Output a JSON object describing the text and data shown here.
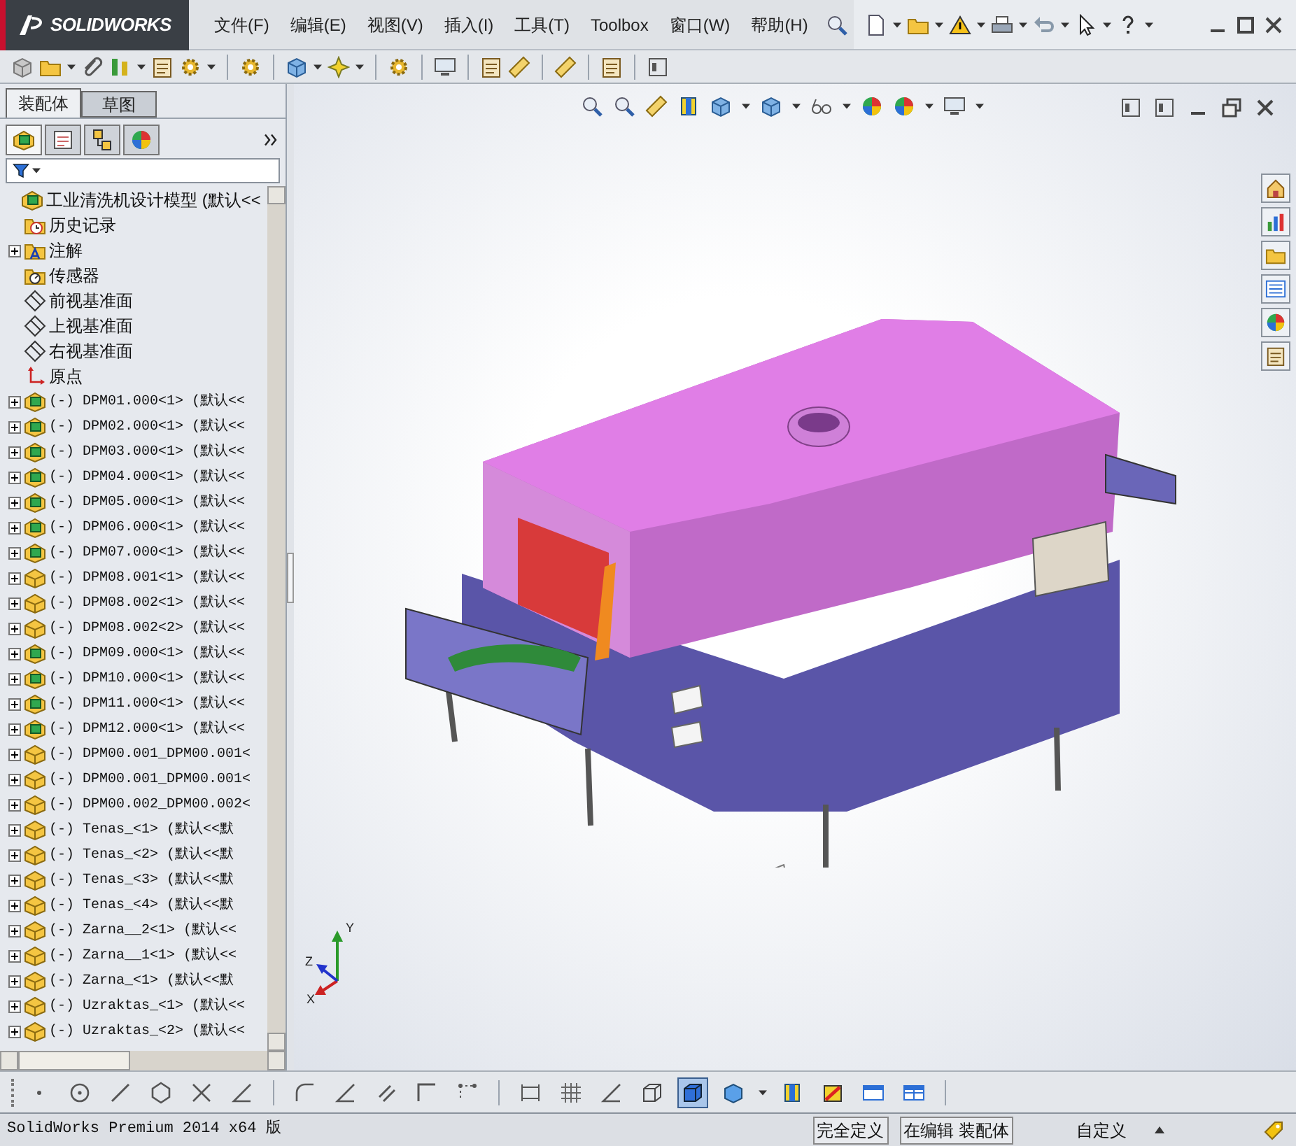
{
  "window": {
    "logo": "SOLIDWORKS"
  },
  "menu": [
    {
      "label": "文件(F)"
    },
    {
      "label": "编辑(E)"
    },
    {
      "label": "视图(V)"
    },
    {
      "label": "插入(I)"
    },
    {
      "label": "工具(T)"
    },
    {
      "label": "Toolbox"
    },
    {
      "label": "窗口(W)"
    },
    {
      "label": "帮助(H)"
    }
  ],
  "panel_tabs": [
    {
      "label": "装配体",
      "selected": true
    },
    {
      "label": "草图",
      "selected": false
    }
  ],
  "manager_tabs": [
    {
      "kind": "tree",
      "selected": true
    },
    {
      "kind": "property",
      "selected": false
    },
    {
      "kind": "config",
      "selected": false
    },
    {
      "kind": "display",
      "selected": false
    }
  ],
  "tree": [
    {
      "kind": "assembly",
      "label": "工业清洗机设计模型 (默认<<",
      "expandable": false,
      "children": [
        {
          "kind": "history",
          "label": "历史记录",
          "expandable": false
        },
        {
          "kind": "annotation",
          "label": "注解",
          "expandable": true
        },
        {
          "kind": "sensor",
          "label": "传感器",
          "expandable": false
        },
        {
          "kind": "plane",
          "label": "前视基准面",
          "expandable": false
        },
        {
          "kind": "plane",
          "label": "上视基准面",
          "expandable": false
        },
        {
          "kind": "plane",
          "label": "右视基准面",
          "expandable": false
        },
        {
          "kind": "origin",
          "label": "原点",
          "expandable": false
        },
        {
          "kind": "assembly",
          "label": "(-) DPM01.000<1> (默认<<",
          "expandable": true
        },
        {
          "kind": "assembly",
          "label": "(-) DPM02.000<1> (默认<<",
          "expandable": true
        },
        {
          "kind": "assembly",
          "label": "(-) DPM03.000<1> (默认<<",
          "expandable": true
        },
        {
          "kind": "assembly",
          "label": "(-) DPM04.000<1> (默认<<",
          "expandable": true
        },
        {
          "kind": "assembly",
          "label": "(-) DPM05.000<1> (默认<<",
          "expandable": true
        },
        {
          "kind": "assembly",
          "label": "(-) DPM06.000<1> (默认<<",
          "expandable": true
        },
        {
          "kind": "assembly",
          "label": "(-) DPM07.000<1> (默认<<",
          "expandable": true
        },
        {
          "kind": "part",
          "label": "(-) DPM08.001<1> (默认<<",
          "expandable": true
        },
        {
          "kind": "part",
          "label": "(-) DPM08.002<1> (默认<<",
          "expandable": true
        },
        {
          "kind": "part",
          "label": "(-) DPM08.002<2> (默认<<",
          "expandable": true
        },
        {
          "kind": "assembly",
          "label": "(-) DPM09.000<1> (默认<<",
          "expandable": true
        },
        {
          "kind": "assembly",
          "label": "(-) DPM10.000<1> (默认<<",
          "expandable": true
        },
        {
          "kind": "assembly",
          "label": "(-) DPM11.000<1> (默认<<",
          "expandable": true
        },
        {
          "kind": "assembly",
          "label": "(-) DPM12.000<1> (默认<<",
          "expandable": true
        },
        {
          "kind": "part",
          "label": "(-) DPM00.001_DPM00.001<",
          "expandable": true
        },
        {
          "kind": "part",
          "label": "(-) DPM00.001_DPM00.001<",
          "expandable": true
        },
        {
          "kind": "part",
          "label": "(-) DPM00.002_DPM00.002<",
          "expandable": true
        },
        {
          "kind": "part",
          "label": "(-) Tenas_<1> (默认<<默",
          "expandable": true
        },
        {
          "kind": "part",
          "label": "(-) Tenas_<2> (默认<<默",
          "expandable": true
        },
        {
          "kind": "part",
          "label": "(-) Tenas_<3> (默认<<默",
          "expandable": true
        },
        {
          "kind": "part",
          "label": "(-) Tenas_<4> (默认<<默",
          "expandable": true
        },
        {
          "kind": "part",
          "label": "(-) Zarna__2<1> (默认<<",
          "expandable": true
        },
        {
          "kind": "part",
          "label": "(-) Zarna__1<1> (默认<<",
          "expandable": true
        },
        {
          "kind": "part",
          "label": "(-) Zarna_<1> (默认<<默",
          "expandable": true
        },
        {
          "kind": "part",
          "label": "(-) Uzraktas_<1> (默认<<",
          "expandable": true
        },
        {
          "kind": "part",
          "label": "(-) Uzraktas_<2> (默认<<",
          "expandable": true
        }
      ]
    }
  ],
  "viewport": {
    "model": {
      "kind": "picture"
    },
    "triad": [
      "Z",
      "Y",
      "X"
    ]
  },
  "sketch_toolbar": [
    {
      "kind": "point",
      "selected": false
    },
    {
      "kind": "circle",
      "selected": false
    },
    {
      "kind": "line",
      "selected": false
    },
    {
      "kind": "polygon",
      "selected": false
    },
    {
      "kind": "trim",
      "selected": false
    },
    {
      "kind": "angle",
      "selected": false
    },
    {
      "kind": "sep"
    },
    {
      "kind": "fillet",
      "selected": false
    },
    {
      "kind": "angle",
      "selected": false
    },
    {
      "kind": "slot",
      "selected": false
    },
    {
      "kind": "corner",
      "selected": false
    },
    {
      "kind": "points",
      "selected": false
    },
    {
      "kind": "sep"
    },
    {
      "kind": "dimension",
      "selected": false
    },
    {
      "kind": "grid",
      "selected": false
    },
    {
      "kind": "angle",
      "selected": false
    },
    {
      "kind": "wire",
      "selected": false
    },
    {
      "kind": "shaded",
      "selected": true
    },
    {
      "kind": "view",
      "selected": false
    },
    {
      "kind": "caret"
    },
    {
      "kind": "section",
      "selected": false
    },
    {
      "kind": "interfere",
      "selected": false
    },
    {
      "kind": "window",
      "selected": false
    },
    {
      "kind": "table",
      "selected": false
    },
    {
      "kind": "sep"
    }
  ],
  "status_bar": {
    "product": "SolidWorks Premium 2014 x64 版",
    "state": "完全定义",
    "mode": "在编辑 装配体",
    "units": "自定义"
  }
}
